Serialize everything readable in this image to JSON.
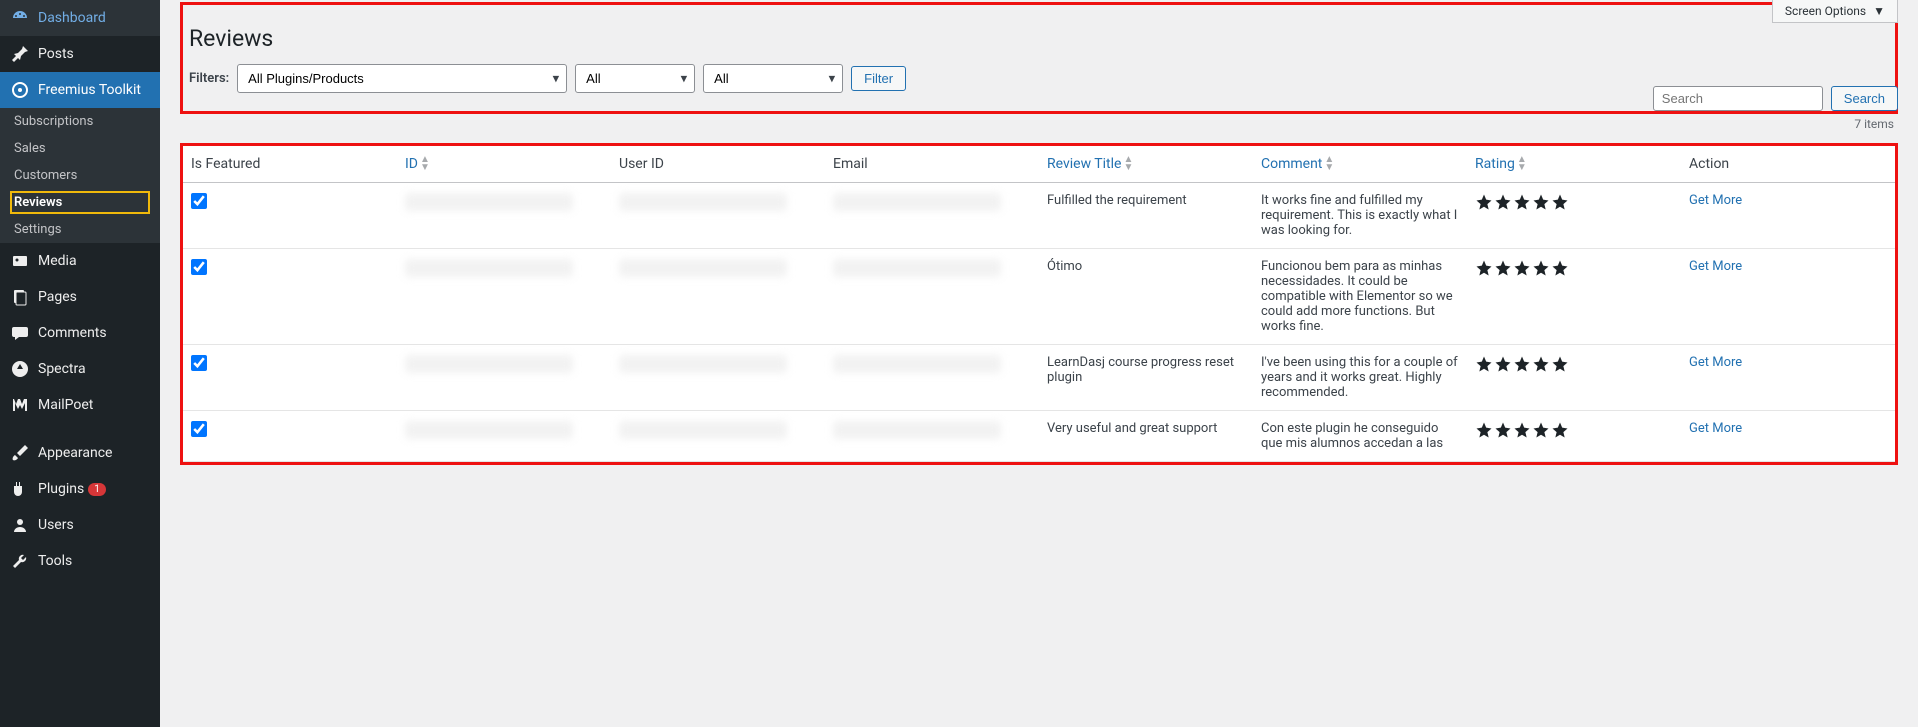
{
  "screen_options": "Screen Options",
  "sidebar": {
    "dashboard": "Dashboard",
    "posts": "Posts",
    "freemius": "Freemius Toolkit",
    "sub": {
      "subscriptions": "Subscriptions",
      "sales": "Sales",
      "customers": "Customers",
      "reviews": "Reviews",
      "settings": "Settings"
    },
    "media": "Media",
    "pages": "Pages",
    "comments": "Comments",
    "spectra": "Spectra",
    "mailpoet": "MailPoet",
    "appearance": "Appearance",
    "plugins": "Plugins",
    "plugins_badge": "1",
    "users": "Users",
    "tools": "Tools"
  },
  "page": {
    "title": "Reviews",
    "filters_label": "Filters:",
    "filter_product": "All Plugins/Products",
    "filter2": "All",
    "filter3": "All",
    "filter_btn": "Filter",
    "search_placeholder": "Search",
    "search_btn": "Search",
    "items_count": "7 items"
  },
  "table": {
    "headers": {
      "is_featured": "Is Featured",
      "id": "ID",
      "user_id": "User ID",
      "email": "Email",
      "review_title": "Review Title",
      "comment": "Comment",
      "rating": "Rating",
      "action": "Action"
    },
    "rows": [
      {
        "featured": true,
        "title": "Fulfilled the requirement",
        "comment": "It works fine and fulfilled my requirement. This is exactly what I was looking for.",
        "rating": 5,
        "action": "Get More"
      },
      {
        "featured": true,
        "title": "Ótimo",
        "comment": "Funcionou bem para as minhas necessidades. It could be compatible with Elementor so we could add more functions. But works fine.",
        "rating": 5,
        "action": "Get More"
      },
      {
        "featured": true,
        "title": "LearnDasj course progress reset plugin",
        "comment": "I've been using this for a couple of years and it works great. Highly recommended.",
        "rating": 5,
        "action": "Get More"
      },
      {
        "featured": true,
        "title": "Very useful and great support",
        "comment": "Con este plugin he conseguido que mis alumnos accedan a las",
        "rating": 5,
        "action": "Get More"
      }
    ]
  }
}
